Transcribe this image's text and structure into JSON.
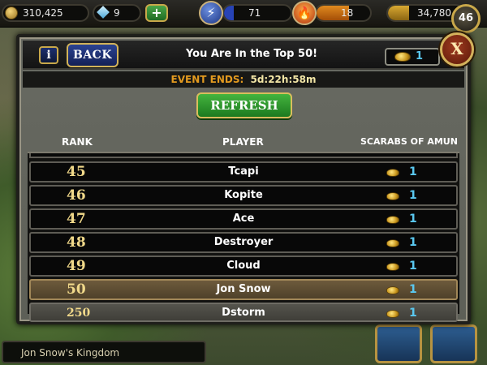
{
  "hud": {
    "coins": "310,425",
    "gems": "9",
    "plus_label": "+",
    "energy": "71",
    "food": "18",
    "gold": "34,780",
    "level": "46"
  },
  "dialog": {
    "info_label": "i",
    "back_label": "BACK",
    "title": "You Are In the Top 50!",
    "scarab_total": "1",
    "close_label": "X",
    "event_label": "EVENT ENDS:",
    "event_time": "5d:22h:58m",
    "refresh_label": "REFRESH",
    "columns": {
      "rank": "RANK",
      "player": "PLAYER",
      "scarabs": "SCARABS OF AMUN"
    },
    "rows": [
      {
        "rank": "45",
        "player": "Tcapi",
        "score": "1"
      },
      {
        "rank": "46",
        "player": "Kopite",
        "score": "1"
      },
      {
        "rank": "47",
        "player": "Ace",
        "score": "1"
      },
      {
        "rank": "48",
        "player": "Destroyer",
        "score": "1"
      },
      {
        "rank": "49",
        "player": "Cloud",
        "score": "1"
      },
      {
        "rank": "50",
        "player": "Jon Snow",
        "score": "1"
      },
      {
        "rank": "250",
        "player": "Dstorm",
        "score": "1"
      }
    ]
  },
  "kingdom": {
    "name": "Jon Snow's Kingdom"
  },
  "colors": {
    "score": "#5ac8f0",
    "rank": "#f1d98a",
    "self_row": "#6d5a3c"
  }
}
